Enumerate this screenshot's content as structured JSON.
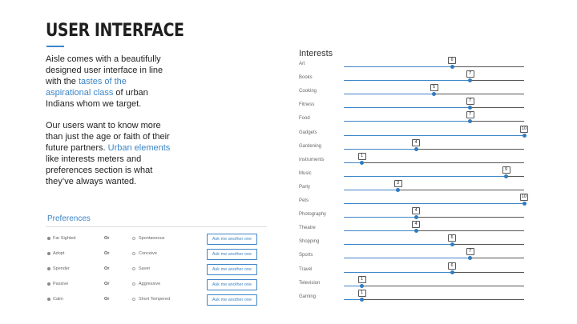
{
  "header": {
    "title": "USER INTERFACE"
  },
  "intro": {
    "p1": [
      "Aisle comes with a beautifully designed user interface in line with the ",
      "tastes of the aspirational class",
      " of urban Indians whom we target."
    ],
    "p2": [
      "Our users want to know more than just the age or faith of their future partners. ",
      "Urban elements",
      " like interests meters and preferences section is what they’ve always wanted."
    ]
  },
  "preferences": {
    "title": "Preferences",
    "or_label": "Or",
    "ask_label": "Ask me another one",
    "rows": [
      {
        "left": "Far Sighted",
        "right": "Spontaneous",
        "selected": "left"
      },
      {
        "left": "Adopt",
        "right": "Conceive",
        "selected": "left"
      },
      {
        "left": "Spender",
        "right": "Saver",
        "selected": "left"
      },
      {
        "left": "Passive",
        "right": "Aggressive",
        "selected": "left"
      },
      {
        "left": "Calm",
        "right": "Short Tempered",
        "selected": "left"
      }
    ]
  },
  "interests": {
    "title": "Interests",
    "max": 10,
    "items": [
      {
        "label": "Art",
        "value": 6
      },
      {
        "label": "Books",
        "value": 7
      },
      {
        "label": "Cooking",
        "value": 5
      },
      {
        "label": "Fitness",
        "value": 7
      },
      {
        "label": "Food",
        "value": 7
      },
      {
        "label": "Gadgets",
        "value": 10
      },
      {
        "label": "Gardening",
        "value": 4
      },
      {
        "label": "Instruments",
        "value": 1
      },
      {
        "label": "Music",
        "value": 9
      },
      {
        "label": "Party",
        "value": 3
      },
      {
        "label": "Pets",
        "value": 10
      },
      {
        "label": "Photography",
        "value": 4
      },
      {
        "label": "Theatre",
        "value": 4
      },
      {
        "label": "Shopping",
        "value": 6
      },
      {
        "label": "Sports",
        "value": 7
      },
      {
        "label": "Travel",
        "value": 6
      },
      {
        "label": "Television",
        "value": 1
      },
      {
        "label": "Gaming",
        "value": 1
      }
    ]
  },
  "colors": {
    "accent": "#3d85c6",
    "track": "#555555",
    "text": "#222222"
  }
}
